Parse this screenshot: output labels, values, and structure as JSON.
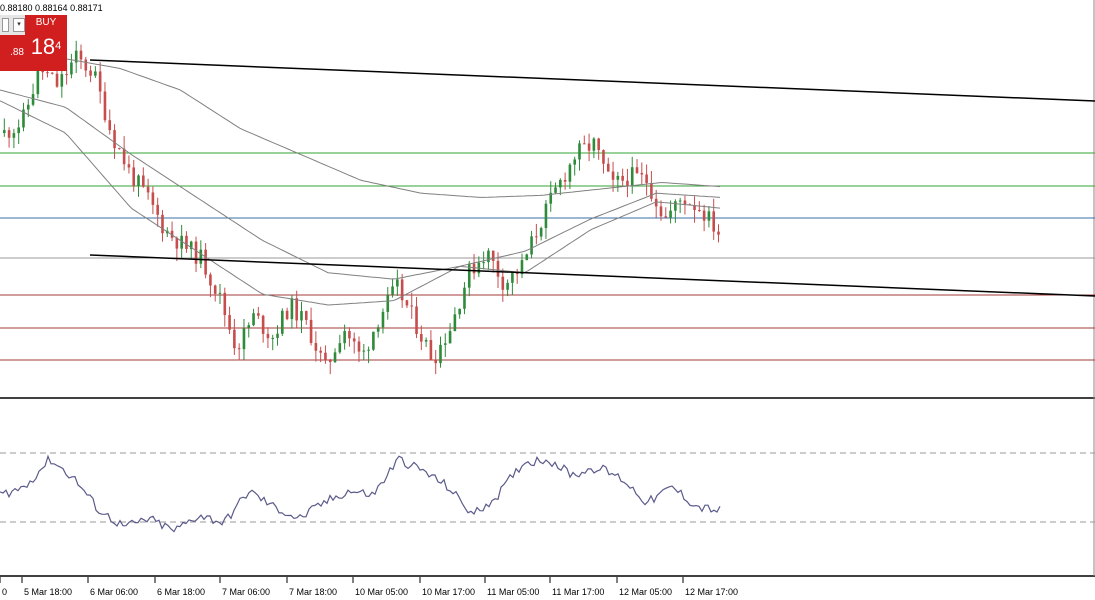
{
  "header": {
    "ohlc_text": "0.88180 0.88164 0.88171"
  },
  "trade_panel": {
    "buy_label": "BUY",
    "sell_price_partial": ".88",
    "buy_price_big": "18",
    "buy_price_small": "4",
    "colors": {
      "buy_bg": "#d11f1f",
      "text": "#ffffff"
    }
  },
  "chart_data": [
    {
      "type": "candlestick",
      "title": "",
      "x_tick_labels": [
        "0",
        "5 Mar 18:00",
        "6 Mar 06:00",
        "6 Mar 18:00",
        "7 Mar 06:00",
        "7 Mar 18:00",
        "10 Mar 05:00",
        "10 Mar 17:00",
        "11 Mar 05:00",
        "11 Mar 17:00",
        "12 Mar 05:00",
        "12 Mar 17:00"
      ],
      "y_axis_visible": false,
      "grid": false,
      "price_path": [
        0.6,
        0.65,
        0.9,
        0.82,
        0.95,
        0.88,
        0.6,
        0.42,
        0.3,
        0.15,
        0.08,
        0.02,
        -0.15,
        -0.4,
        -0.25,
        -0.35,
        -0.2,
        -0.3,
        -0.5,
        -0.3,
        -0.45,
        -0.25,
        -0.12,
        -0.28,
        -0.45,
        -0.3,
        -0.05,
        0.05,
        -0.1,
        -0.02,
        0.18,
        0.35,
        0.5,
        0.55,
        0.35,
        0.4,
        0.38,
        0.2,
        0.3,
        0.25,
        0.14
      ],
      "moving_averages": [
        {
          "color": "#808080",
          "anchor_path": [
            0.95,
            0.9,
            0.8,
            0.62,
            0.5,
            0.38,
            0.32,
            0.3,
            0.31,
            0.34,
            0.37,
            0.35
          ]
        },
        {
          "color": "#808080",
          "anchor_path": [
            0.8,
            0.72,
            0.5,
            0.3,
            0.1,
            -0.05,
            -0.08,
            -0.02,
            0.05,
            0.2,
            0.32,
            0.3
          ]
        },
        {
          "color": "#808080",
          "anchor_path": [
            0.75,
            0.6,
            0.25,
            0.05,
            -0.15,
            -0.2,
            -0.18,
            -0.02,
            -0.05,
            0.15,
            0.28,
            0.25
          ]
        }
      ],
      "horizontal_levels": [
        {
          "role": "resistance",
          "color": "#33a633"
        },
        {
          "role": "resistance",
          "color": "#33a633"
        },
        {
          "role": "pivot",
          "color": "#3a6fa6"
        },
        {
          "role": "current",
          "color": "#9a9a9a"
        },
        {
          "role": "support",
          "color": "#a33838"
        },
        {
          "role": "support",
          "color": "#a33838"
        },
        {
          "role": "support",
          "color": "#a33838"
        }
      ],
      "trendlines": [
        {
          "role": "upper",
          "color": "#000000"
        },
        {
          "role": "lower",
          "color": "#000000"
        }
      ],
      "colors": {
        "bull": "#2e8b3a",
        "bear": "#c74d4d",
        "background": "#ffffff"
      }
    },
    {
      "type": "line",
      "title": "",
      "indicator": "oscillator",
      "line_color": "#5a5a8a",
      "levels_style": "dashed",
      "path": [
        0.5,
        0.6,
        0.95,
        0.7,
        0.3,
        0.1,
        0.2,
        0.05,
        0.25,
        0.15,
        0.55,
        0.35,
        0.2,
        0.4,
        0.55,
        0.5,
        0.95,
        0.8,
        0.6,
        0.25,
        0.5,
        0.9,
        0.95,
        0.75,
        0.85,
        0.7,
        0.4,
        0.6,
        0.35,
        0.3
      ]
    }
  ]
}
